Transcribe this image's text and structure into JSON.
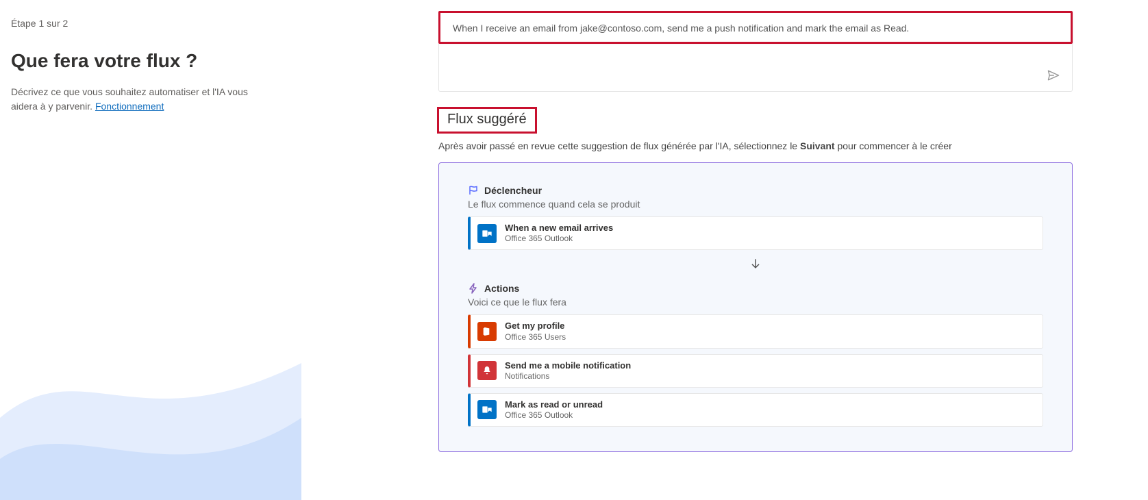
{
  "left": {
    "step": "Étape 1 sur 2",
    "heading": "Que fera votre flux ?",
    "desc_before": "Décrivez ce que vous souhaitez automatiser et l'IA vous aidera à y parvenir. ",
    "link": "Fonctionnement"
  },
  "prompt": {
    "text": "When I receive an email from jake@contoso.com, send me a push notification and mark the email as Read."
  },
  "suggest": {
    "title": "Flux suggéré",
    "sub_before": "Après avoir passé en revue cette suggestion de flux générée par l'IA, sélectionnez le ",
    "sub_bold": "Suivant",
    "sub_after": " pour commencer à le créer"
  },
  "trigger": {
    "label": "Déclencheur",
    "desc": "Le flux commence quand cela se produit",
    "card": {
      "title": "When a new email arrives",
      "sub": "Office 365 Outlook"
    }
  },
  "actions": {
    "label": "Actions",
    "desc": "Voici ce que le flux fera",
    "items": [
      {
        "title": "Get my profile",
        "sub": "Office 365 Users",
        "kind": "office"
      },
      {
        "title": "Send me a mobile notification",
        "sub": "Notifications",
        "kind": "notif"
      },
      {
        "title": "Mark as read or unread",
        "sub": "Office 365 Outlook",
        "kind": "outlook"
      }
    ]
  }
}
